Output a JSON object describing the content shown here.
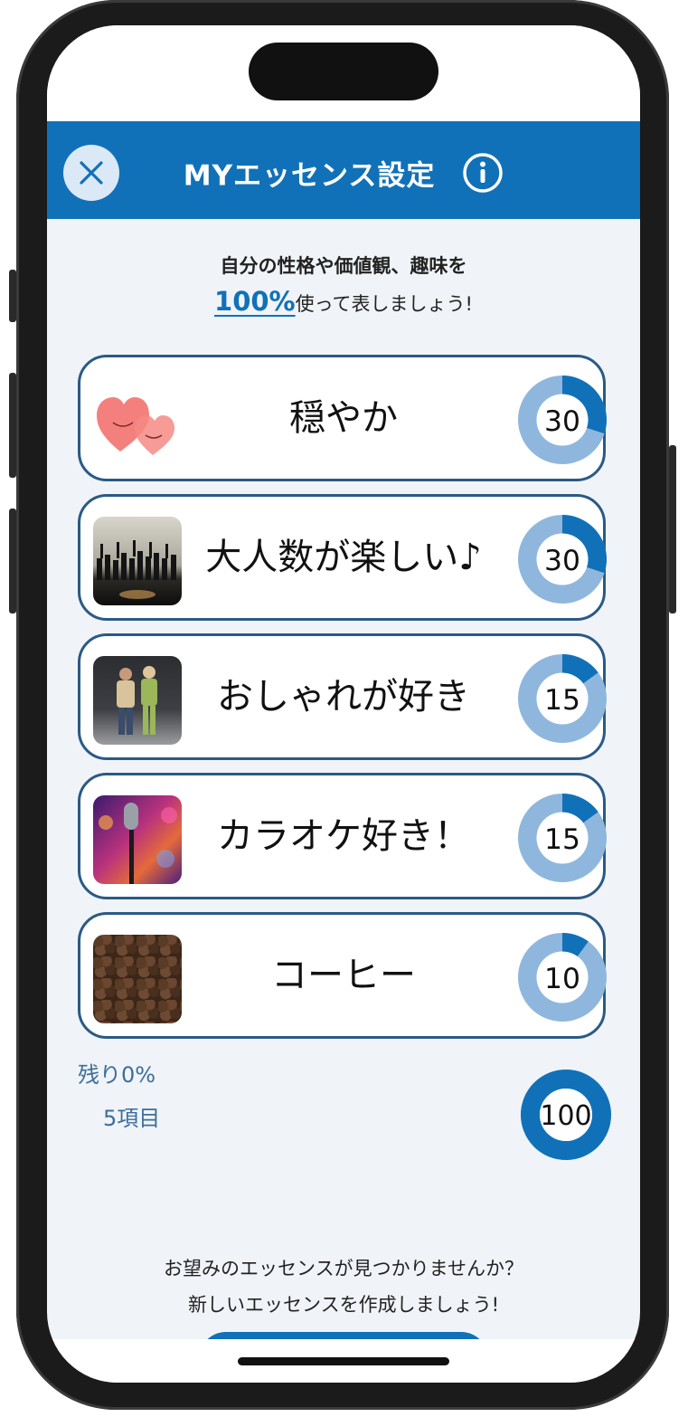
{
  "header": {
    "title": "MYエッセンス設定"
  },
  "intro": {
    "line1": "自分の性格や価値観、趣味を",
    "percent": "100%",
    "line2_suffix": "使って表しましょう!"
  },
  "essences": [
    {
      "label": "穏やか",
      "value": 30,
      "value_text": "30",
      "image": "hearts"
    },
    {
      "label": "大人数が楽しい♪",
      "value": 30,
      "value_text": "30",
      "image": "crowd"
    },
    {
      "label": "おしゃれが好き",
      "value": 15,
      "value_text": "15",
      "image": "fashion"
    },
    {
      "label": "カラオケ好き！",
      "value": 15,
      "value_text": "15",
      "image": "microphone"
    },
    {
      "label": "コーヒー",
      "value": 10,
      "value_text": "10",
      "image": "coffee"
    }
  ],
  "summary": {
    "remaining": "残り0%",
    "count": "5項目",
    "total": "100",
    "total_value": 100
  },
  "footer": {
    "line1": "お望みのエッセンスが見つかりませんか？",
    "line2": "新しいエッセンスを作成しましょう!"
  },
  "colors": {
    "accent": "#1171b8",
    "ring_light": "#8fb7dd",
    "card_border": "#2a5a86",
    "background": "#f0f4f8"
  }
}
